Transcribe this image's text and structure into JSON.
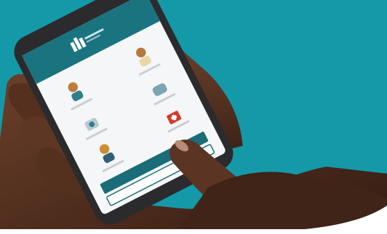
{
  "colors": {
    "background": "#1499a8",
    "skin_dark": "#3a2116",
    "skin_mid": "#5a3524",
    "skin_light": "#7a4a33",
    "phone_body": "#2b2b2d",
    "app_header": "#1a7480",
    "app_button": "#1a6d78",
    "screen_bg": "#f4f6f7",
    "bottom_band": "#ffffff"
  },
  "icons": [
    "logo-icon",
    "person-icon",
    "doctor-icon",
    "medicine-icon",
    "hands-icon",
    "first-aid-icon",
    "worker-icon"
  ]
}
